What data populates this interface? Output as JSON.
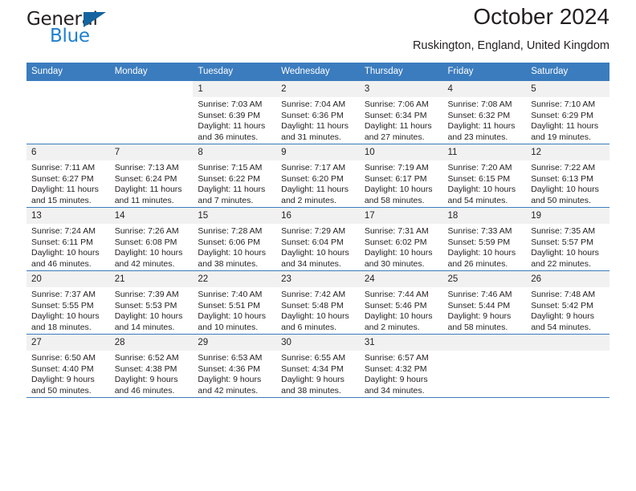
{
  "brand": {
    "name_part1": "General",
    "name_part2": "Blue",
    "triangle_icon": "triangle-icon",
    "color_dark": "#231f20",
    "color_blue": "#1f7fd0"
  },
  "header": {
    "title": "October 2024",
    "subtitle": "Ruskington, England, United Kingdom"
  },
  "theme": {
    "header_row_bg": "#3b7cbe",
    "header_row_text": "#ffffff",
    "daynum_bg": "#f1f1f1",
    "grid_line": "#3b7cbe",
    "body_text": "#231f20"
  },
  "calendar": {
    "weekday_headers": [
      "Sunday",
      "Monday",
      "Tuesday",
      "Wednesday",
      "Thursday",
      "Friday",
      "Saturday"
    ],
    "labels": {
      "sunrise": "Sunrise:",
      "sunset": "Sunset:",
      "daylight": "Daylight:"
    },
    "weeks": [
      [
        {
          "day": "",
          "empty": true
        },
        {
          "day": "",
          "empty": true
        },
        {
          "day": "1",
          "sunrise": "Sunrise: 7:03 AM",
          "sunset": "Sunset: 6:39 PM",
          "daylight_l1": "Daylight: 11 hours",
          "daylight_l2": "and 36 minutes."
        },
        {
          "day": "2",
          "sunrise": "Sunrise: 7:04 AM",
          "sunset": "Sunset: 6:36 PM",
          "daylight_l1": "Daylight: 11 hours",
          "daylight_l2": "and 31 minutes."
        },
        {
          "day": "3",
          "sunrise": "Sunrise: 7:06 AM",
          "sunset": "Sunset: 6:34 PM",
          "daylight_l1": "Daylight: 11 hours",
          "daylight_l2": "and 27 minutes."
        },
        {
          "day": "4",
          "sunrise": "Sunrise: 7:08 AM",
          "sunset": "Sunset: 6:32 PM",
          "daylight_l1": "Daylight: 11 hours",
          "daylight_l2": "and 23 minutes."
        },
        {
          "day": "5",
          "sunrise": "Sunrise: 7:10 AM",
          "sunset": "Sunset: 6:29 PM",
          "daylight_l1": "Daylight: 11 hours",
          "daylight_l2": "and 19 minutes."
        }
      ],
      [
        {
          "day": "6",
          "sunrise": "Sunrise: 7:11 AM",
          "sunset": "Sunset: 6:27 PM",
          "daylight_l1": "Daylight: 11 hours",
          "daylight_l2": "and 15 minutes."
        },
        {
          "day": "7",
          "sunrise": "Sunrise: 7:13 AM",
          "sunset": "Sunset: 6:24 PM",
          "daylight_l1": "Daylight: 11 hours",
          "daylight_l2": "and 11 minutes."
        },
        {
          "day": "8",
          "sunrise": "Sunrise: 7:15 AM",
          "sunset": "Sunset: 6:22 PM",
          "daylight_l1": "Daylight: 11 hours",
          "daylight_l2": "and 7 minutes."
        },
        {
          "day": "9",
          "sunrise": "Sunrise: 7:17 AM",
          "sunset": "Sunset: 6:20 PM",
          "daylight_l1": "Daylight: 11 hours",
          "daylight_l2": "and 2 minutes."
        },
        {
          "day": "10",
          "sunrise": "Sunrise: 7:19 AM",
          "sunset": "Sunset: 6:17 PM",
          "daylight_l1": "Daylight: 10 hours",
          "daylight_l2": "and 58 minutes."
        },
        {
          "day": "11",
          "sunrise": "Sunrise: 7:20 AM",
          "sunset": "Sunset: 6:15 PM",
          "daylight_l1": "Daylight: 10 hours",
          "daylight_l2": "and 54 minutes."
        },
        {
          "day": "12",
          "sunrise": "Sunrise: 7:22 AM",
          "sunset": "Sunset: 6:13 PM",
          "daylight_l1": "Daylight: 10 hours",
          "daylight_l2": "and 50 minutes."
        }
      ],
      [
        {
          "day": "13",
          "sunrise": "Sunrise: 7:24 AM",
          "sunset": "Sunset: 6:11 PM",
          "daylight_l1": "Daylight: 10 hours",
          "daylight_l2": "and 46 minutes."
        },
        {
          "day": "14",
          "sunrise": "Sunrise: 7:26 AM",
          "sunset": "Sunset: 6:08 PM",
          "daylight_l1": "Daylight: 10 hours",
          "daylight_l2": "and 42 minutes."
        },
        {
          "day": "15",
          "sunrise": "Sunrise: 7:28 AM",
          "sunset": "Sunset: 6:06 PM",
          "daylight_l1": "Daylight: 10 hours",
          "daylight_l2": "and 38 minutes."
        },
        {
          "day": "16",
          "sunrise": "Sunrise: 7:29 AM",
          "sunset": "Sunset: 6:04 PM",
          "daylight_l1": "Daylight: 10 hours",
          "daylight_l2": "and 34 minutes."
        },
        {
          "day": "17",
          "sunrise": "Sunrise: 7:31 AM",
          "sunset": "Sunset: 6:02 PM",
          "daylight_l1": "Daylight: 10 hours",
          "daylight_l2": "and 30 minutes."
        },
        {
          "day": "18",
          "sunrise": "Sunrise: 7:33 AM",
          "sunset": "Sunset: 5:59 PM",
          "daylight_l1": "Daylight: 10 hours",
          "daylight_l2": "and 26 minutes."
        },
        {
          "day": "19",
          "sunrise": "Sunrise: 7:35 AM",
          "sunset": "Sunset: 5:57 PM",
          "daylight_l1": "Daylight: 10 hours",
          "daylight_l2": "and 22 minutes."
        }
      ],
      [
        {
          "day": "20",
          "sunrise": "Sunrise: 7:37 AM",
          "sunset": "Sunset: 5:55 PM",
          "daylight_l1": "Daylight: 10 hours",
          "daylight_l2": "and 18 minutes."
        },
        {
          "day": "21",
          "sunrise": "Sunrise: 7:39 AM",
          "sunset": "Sunset: 5:53 PM",
          "daylight_l1": "Daylight: 10 hours",
          "daylight_l2": "and 14 minutes."
        },
        {
          "day": "22",
          "sunrise": "Sunrise: 7:40 AM",
          "sunset": "Sunset: 5:51 PM",
          "daylight_l1": "Daylight: 10 hours",
          "daylight_l2": "and 10 minutes."
        },
        {
          "day": "23",
          "sunrise": "Sunrise: 7:42 AM",
          "sunset": "Sunset: 5:48 PM",
          "daylight_l1": "Daylight: 10 hours",
          "daylight_l2": "and 6 minutes."
        },
        {
          "day": "24",
          "sunrise": "Sunrise: 7:44 AM",
          "sunset": "Sunset: 5:46 PM",
          "daylight_l1": "Daylight: 10 hours",
          "daylight_l2": "and 2 minutes."
        },
        {
          "day": "25",
          "sunrise": "Sunrise: 7:46 AM",
          "sunset": "Sunset: 5:44 PM",
          "daylight_l1": "Daylight: 9 hours",
          "daylight_l2": "and 58 minutes."
        },
        {
          "day": "26",
          "sunrise": "Sunrise: 7:48 AM",
          "sunset": "Sunset: 5:42 PM",
          "daylight_l1": "Daylight: 9 hours",
          "daylight_l2": "and 54 minutes."
        }
      ],
      [
        {
          "day": "27",
          "sunrise": "Sunrise: 6:50 AM",
          "sunset": "Sunset: 4:40 PM",
          "daylight_l1": "Daylight: 9 hours",
          "daylight_l2": "and 50 minutes."
        },
        {
          "day": "28",
          "sunrise": "Sunrise: 6:52 AM",
          "sunset": "Sunset: 4:38 PM",
          "daylight_l1": "Daylight: 9 hours",
          "daylight_l2": "and 46 minutes."
        },
        {
          "day": "29",
          "sunrise": "Sunrise: 6:53 AM",
          "sunset": "Sunset: 4:36 PM",
          "daylight_l1": "Daylight: 9 hours",
          "daylight_l2": "and 42 minutes."
        },
        {
          "day": "30",
          "sunrise": "Sunrise: 6:55 AM",
          "sunset": "Sunset: 4:34 PM",
          "daylight_l1": "Daylight: 9 hours",
          "daylight_l2": "and 38 minutes."
        },
        {
          "day": "31",
          "sunrise": "Sunrise: 6:57 AM",
          "sunset": "Sunset: 4:32 PM",
          "daylight_l1": "Daylight: 9 hours",
          "daylight_l2": "and 34 minutes."
        },
        {
          "day": "",
          "trailing": true
        },
        {
          "day": "",
          "trailing": true
        }
      ]
    ]
  }
}
